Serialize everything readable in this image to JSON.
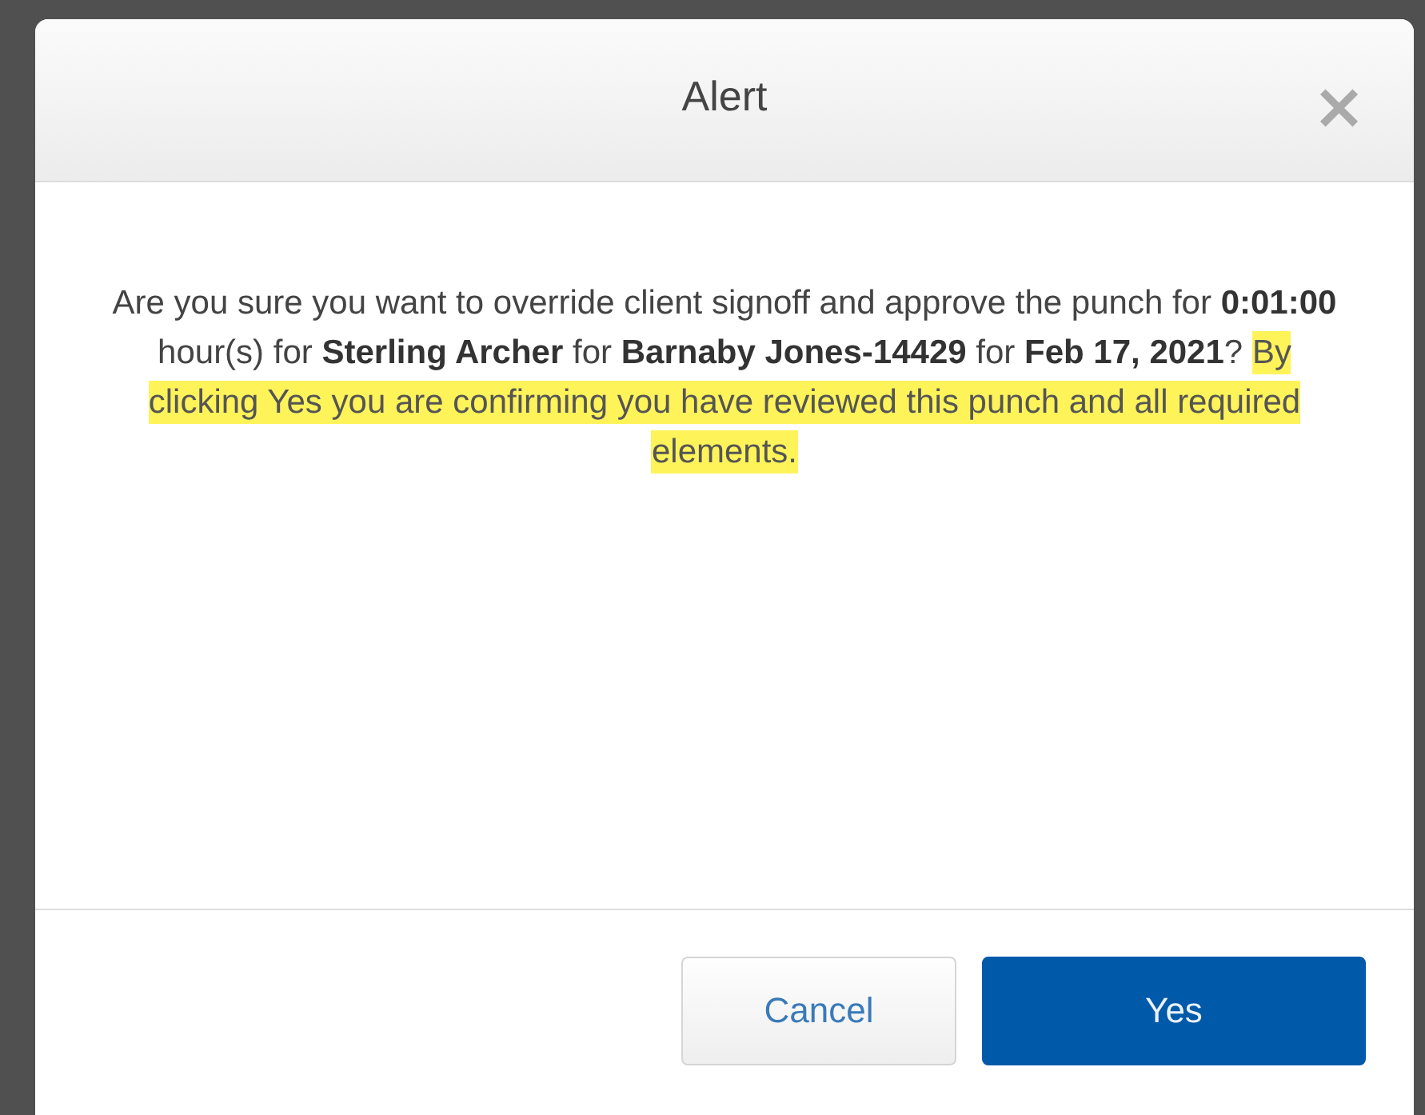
{
  "dialog": {
    "title": "Alert",
    "close": "×",
    "message": "Are you sure you want to override client signoff and approve the punch for **0:01:00** hour(s) for **Sterling Archer** for **Barnaby Jones-14429** for **Feb 17, 2021**? ",
    "highlight": "By clicking Yes you are confirming you have reviewed this punch and all required elements.",
    "buttons": [
      {
        "label": "Cancel",
        "kind": "secondary"
      },
      {
        "label": "Yes",
        "kind": "primary"
      }
    ]
  }
}
